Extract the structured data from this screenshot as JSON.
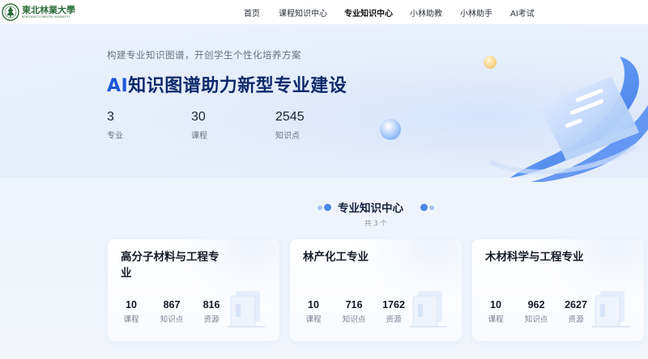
{
  "logo": {
    "name_cn": "東北林業大學",
    "name_en": "NORTHEAST FORESTRY UNIVERSITY"
  },
  "nav": {
    "items": [
      {
        "label": "首页"
      },
      {
        "label": "课程知识中心"
      },
      {
        "label": "专业知识中心",
        "active": true
      },
      {
        "label": "小林助教"
      },
      {
        "label": "小林助手"
      },
      {
        "label": "AI考试"
      }
    ]
  },
  "hero": {
    "subtitle": "构建专业知识图谱，开创学生个性化培养方案",
    "title_ai": "AI",
    "title_rest": "知识图谱助力新型专业建设",
    "stats": [
      {
        "value": "3",
        "label": "专业"
      },
      {
        "value": "30",
        "label": "课程"
      },
      {
        "value": "2545",
        "label": "知识点"
      }
    ]
  },
  "section": {
    "title": "专业知识中心",
    "count": "共 3 个"
  },
  "cards": [
    {
      "title": "高分子材料与工程专业",
      "stats": [
        {
          "value": "10",
          "label": "课程"
        },
        {
          "value": "867",
          "label": "知识点"
        },
        {
          "value": "816",
          "label": "资源"
        }
      ]
    },
    {
      "title": "林产化工专业",
      "stats": [
        {
          "value": "10",
          "label": "课程"
        },
        {
          "value": "716",
          "label": "知识点"
        },
        {
          "value": "1762",
          "label": "资源"
        }
      ]
    },
    {
      "title": "木材科学与工程专业",
      "stats": [
        {
          "value": "10",
          "label": "课程"
        },
        {
          "value": "962",
          "label": "知识点"
        },
        {
          "value": "2627",
          "label": "资源"
        }
      ]
    }
  ],
  "colors": {
    "title_blue": "#0f2a6b",
    "ai_blue": "#1c56d8",
    "logo_green": "#2d6b3a",
    "accent": "#3a7ae8"
  }
}
